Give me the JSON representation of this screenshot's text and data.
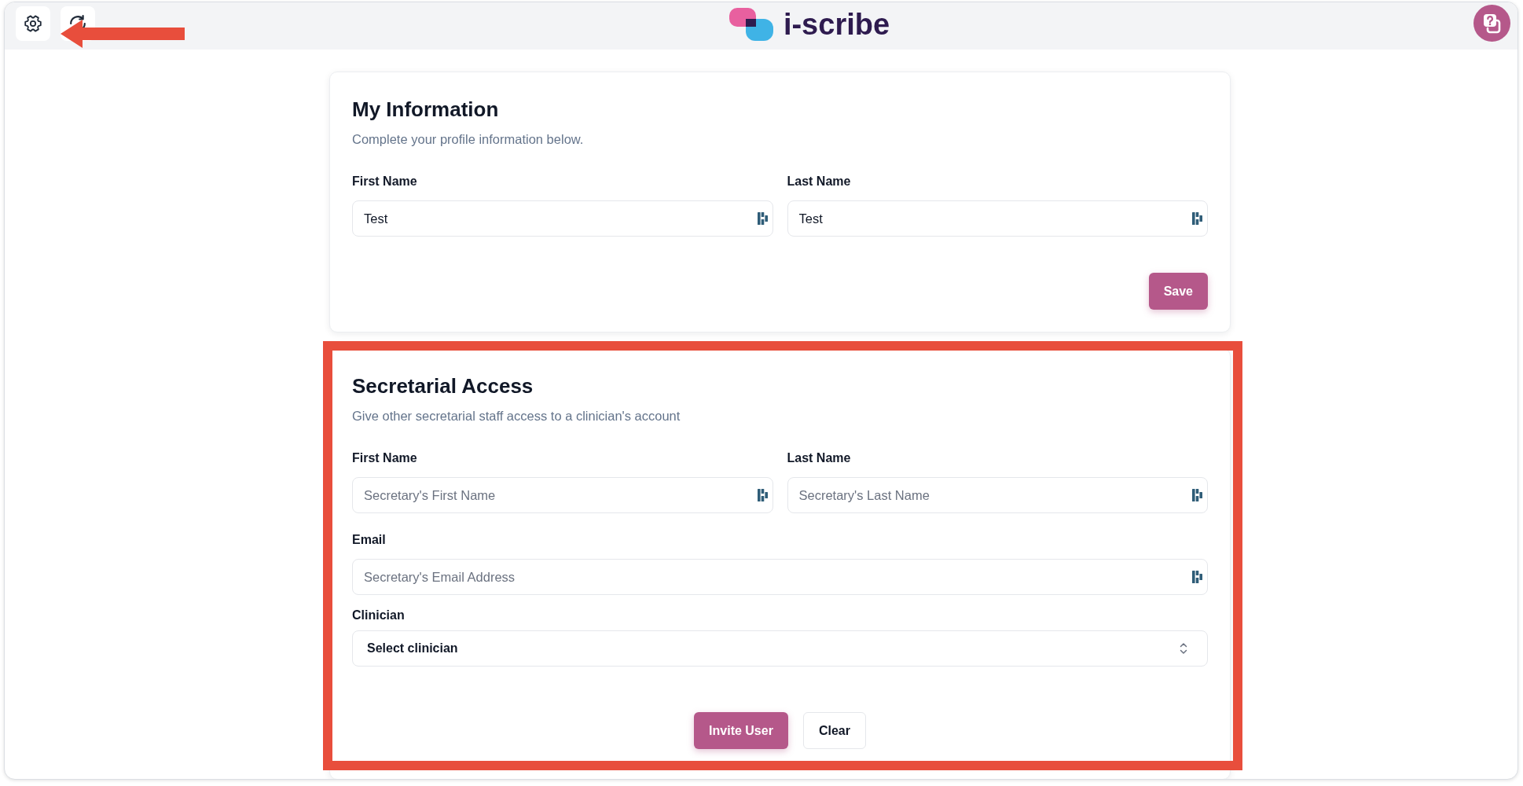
{
  "header": {
    "tool_buttons": [
      {
        "kind": "settings",
        "highlighted": true
      },
      {
        "kind": "refresh",
        "highlighted": false
      }
    ],
    "brand": "i-scribe"
  },
  "sections": [
    {
      "title": "My Information",
      "subtitle": "Complete your profile information below.",
      "highlighted": false,
      "rows": [
        [
          {
            "kind": "input",
            "label": "First Name",
            "value": "Test"
          },
          {
            "kind": "input",
            "label": "Last Name",
            "value": "Test"
          }
        ]
      ],
      "buttons": [
        {
          "kind": "primary",
          "label": "Save"
        }
      ]
    },
    {
      "title": "Secretarial Access",
      "subtitle": "Give other secretarial staff access to a clinician's account",
      "highlighted": true,
      "rows": [
        [
          {
            "kind": "input",
            "label": "First Name",
            "placeholder": "Secretary's First Name"
          },
          {
            "kind": "input",
            "label": "Last Name",
            "placeholder": "Secretary's Last Name"
          }
        ],
        [
          {
            "kind": "input",
            "label": "Email",
            "placeholder": "Secretary's Email Address"
          }
        ],
        [
          {
            "kind": "select",
            "label": "Clinician",
            "value": "Select clinician"
          }
        ]
      ],
      "buttons": [
        {
          "kind": "primary",
          "label": "Invite User"
        },
        {
          "kind": "secondary",
          "label": "Clear"
        }
      ]
    }
  ]
}
